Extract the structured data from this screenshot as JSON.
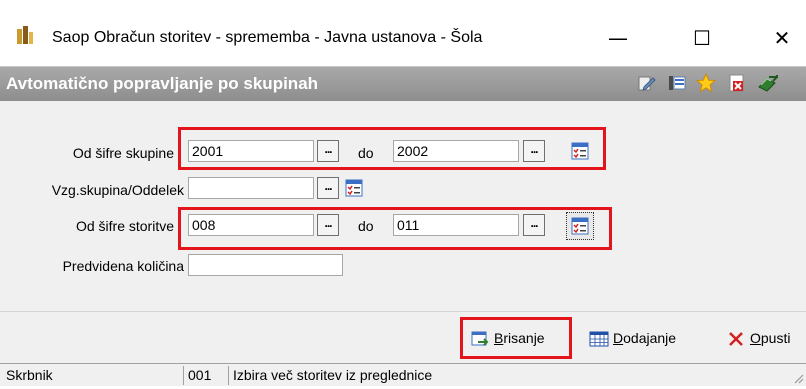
{
  "window": {
    "title": "Saop Obračun storitev - sprememba - Javna ustanova - Šola",
    "minimize_glyph": "—",
    "maximize_glyph": "☐",
    "close_glyph": "✕"
  },
  "header": {
    "title": "Avtomatično popravljanje po skupinah",
    "icons": [
      "edit-icon",
      "columns-icon",
      "star-icon",
      "close-document-icon",
      "exit-book-icon"
    ]
  },
  "form": {
    "row1": {
      "label": "Od šifre skupine",
      "from_value": "2001",
      "to_label": "do",
      "to_value": "2002"
    },
    "row2": {
      "label": "Vzg.skupina/Oddelek",
      "value": ""
    },
    "row3": {
      "label": "Od šifre storitve",
      "from_value": "008",
      "to_label": "do",
      "to_value": "011"
    },
    "row4": {
      "label": "Predvidena količina",
      "value": ""
    },
    "lookup_glyph": "..."
  },
  "buttons": {
    "delete": {
      "accel": "B",
      "rest": "risanje"
    },
    "add": {
      "accel": "D",
      "rest": "odajanje"
    },
    "cancel": {
      "accel": "O",
      "rest": "pusti"
    }
  },
  "status": {
    "user": "Skrbnik",
    "code": "001",
    "message": "Izbira več storitev iz preglednice"
  },
  "colors": {
    "header_band": "#9a9a9a",
    "highlight_box": "#e3141b",
    "form_background": "#f0f0f0"
  }
}
